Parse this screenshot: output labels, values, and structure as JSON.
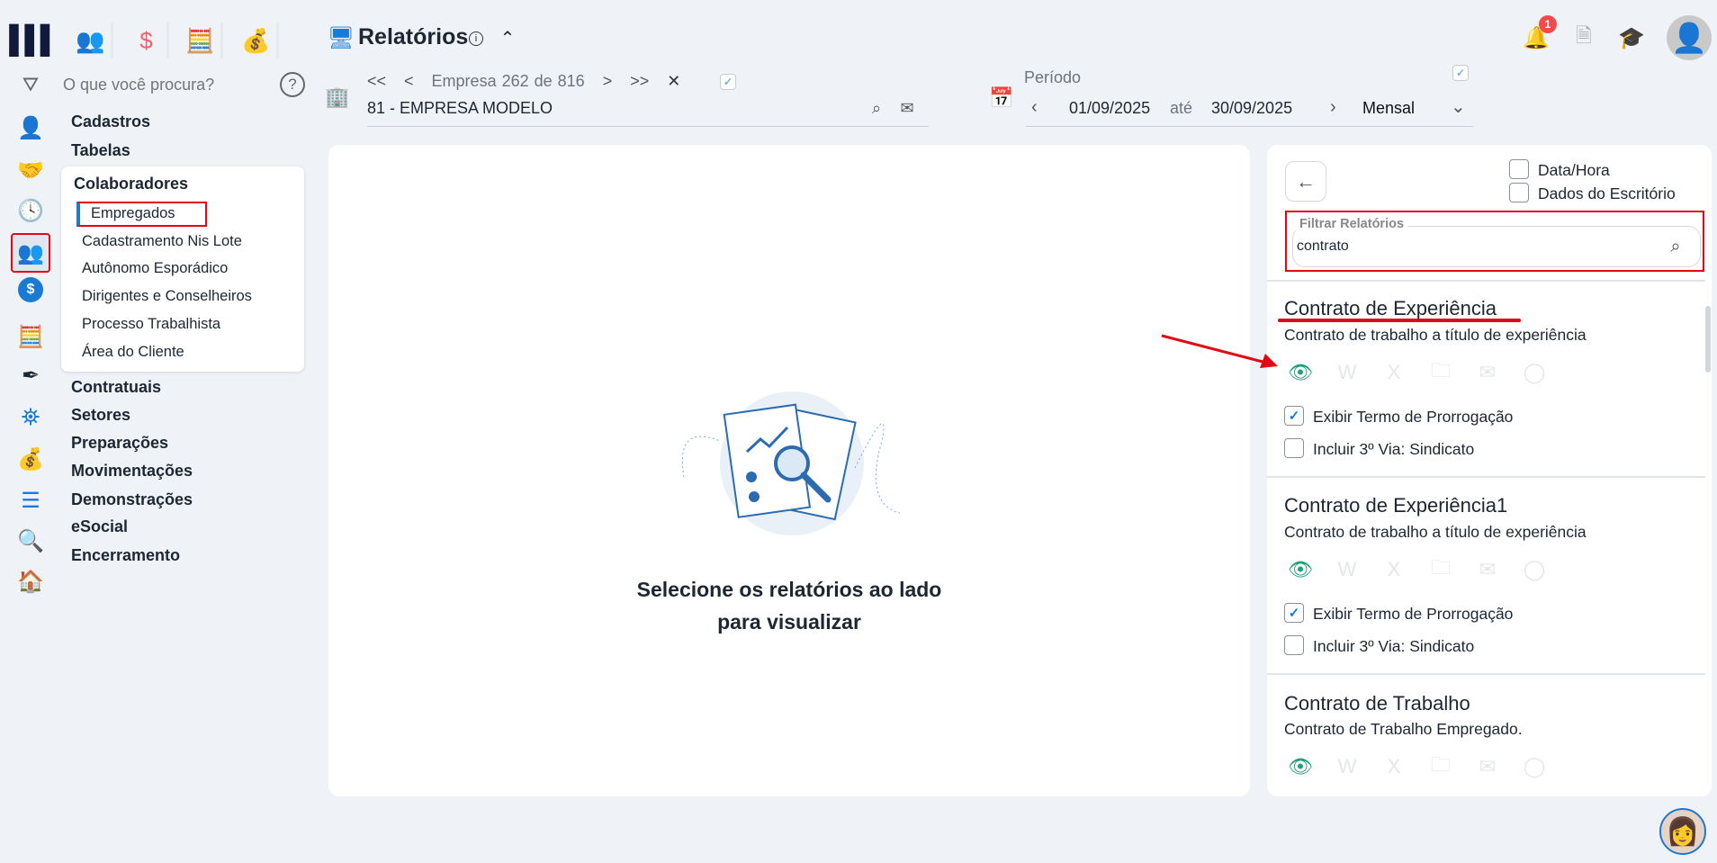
{
  "header": {
    "title": "Relatórios",
    "notifications": "1"
  },
  "search": {
    "placeholder": "O que você procura?"
  },
  "menu": {
    "cadastros": "Cadastros",
    "tabelas": "Tabelas",
    "group": "Colaboradores",
    "sub": [
      "Empregados",
      "Cadastramento Nis Lote",
      "Autônomo Esporádico",
      "Dirigentes e Conselheiros",
      "Processo Trabalhista",
      "Área do Cliente"
    ],
    "rest": [
      "Contratuais",
      "Setores",
      "Preparações",
      "Movimentações",
      "Demonstrações",
      "eSocial",
      "Encerramento"
    ]
  },
  "empresa": {
    "label": "Empresa",
    "current": "262",
    "of": "de",
    "total": "816",
    "name": "81 - EMPRESA MODELO",
    "first": "<<",
    "prev": "<",
    "next": ">",
    "last": ">>",
    "clear": "✕"
  },
  "periodo": {
    "label": "Período",
    "start": "01/09/2025",
    "sep": "até",
    "end": "30/09/2025",
    "mode": "Mensal"
  },
  "main": {
    "empty_line1": "Selecione os relatórios ao lado",
    "empty_line2": "para visualizar"
  },
  "panel": {
    "opt1": "Data/Hora",
    "opt2": "Dados do Escritório",
    "filter_label": "Filtrar Relatórios",
    "filter_value": "contrato",
    "reports": [
      {
        "title": "Contrato de Experiência",
        "desc": "Contrato de trabalho a título de experiência",
        "opt1": "Exibir Termo de Prorrogação",
        "opt1_checked": true,
        "opt2": "Incluir 3º Via: Sindicato",
        "opt2_checked": false
      },
      {
        "title": "Contrato de Experiência1",
        "desc": "Contrato de trabalho a título de experiência",
        "opt1": "Exibir Termo de Prorrogação",
        "opt1_checked": true,
        "opt2": "Incluir 3º Via: Sindicato",
        "opt2_checked": false
      },
      {
        "title": "Contrato de Trabalho",
        "desc": "Contrato de Trabalho Empregado."
      }
    ]
  },
  "colors": {
    "accent": "#1b7ad4",
    "highlight": "#e30613",
    "eye": "#1aa37a",
    "badge": "#ef4b4b"
  }
}
